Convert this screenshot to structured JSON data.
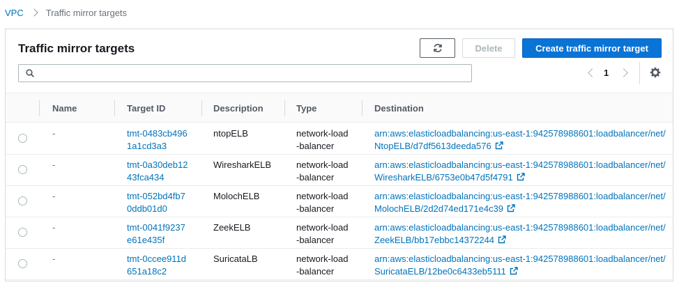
{
  "breadcrumb": {
    "root": "VPC",
    "current": "Traffic mirror targets"
  },
  "panel": {
    "title": "Traffic mirror targets"
  },
  "toolbar": {
    "delete_label": "Delete",
    "create_label": "Create traffic mirror target"
  },
  "search": {
    "placeholder": "",
    "value": ""
  },
  "pagination": {
    "current_page": "1"
  },
  "columns": [
    "Name",
    "Target ID",
    "Description",
    "Type",
    "Destination"
  ],
  "rows": [
    {
      "name": "-",
      "target_id_1": "tmt-0483cb496",
      "target_id_2": "1a1cd3a3",
      "description": "ntopELB",
      "type_1": "network-load",
      "type_2": "-balancer",
      "dest_1": "arn:aws:elasticloadbalancing:us-east-1:942578988601:loadbalancer/net/",
      "dest_2": "NtopELB/d7df5613deeda576"
    },
    {
      "name": "-",
      "target_id_1": "tmt-0a30deb12",
      "target_id_2": "43fca434",
      "description": "WiresharkELB",
      "type_1": "network-load",
      "type_2": "-balancer",
      "dest_1": "arn:aws:elasticloadbalancing:us-east-1:942578988601:loadbalancer/net/",
      "dest_2": "WiresharkELB/6753e0b47d5f4791"
    },
    {
      "name": "-",
      "target_id_1": "tmt-052bd4fb7",
      "target_id_2": "0ddb01d0",
      "description": "MolochELB",
      "type_1": "network-load",
      "type_2": "-balancer",
      "dest_1": "arn:aws:elasticloadbalancing:us-east-1:942578988601:loadbalancer/net/",
      "dest_2": "MolochELB/2d2d74ed171e4c39"
    },
    {
      "name": "-",
      "target_id_1": "tmt-0041f9237",
      "target_id_2": "e61e435f",
      "description": "ZeekELB",
      "type_1": "network-load",
      "type_2": "-balancer",
      "dest_1": "arn:aws:elasticloadbalancing:us-east-1:942578988601:loadbalancer/net/",
      "dest_2": "ZeekELB/bb17ebbc14372244"
    },
    {
      "name": "-",
      "target_id_1": "tmt-0ccee911d",
      "target_id_2": "651a18c2",
      "description": "SuricataLB",
      "type_1": "network-load",
      "type_2": "-balancer",
      "dest_1": "arn:aws:elasticloadbalancing:us-east-1:942578988601:loadbalancer/net/",
      "dest_2": "SuricataELB/12be0c6433eb5111"
    }
  ],
  "icons": {
    "refresh": "refresh-icon",
    "search": "search-icon",
    "settings": "gear-icon",
    "external": "external-link-icon"
  },
  "colors": {
    "link": "#0073bb",
    "primary_button": "#0a73d6",
    "disabled_text": "#aab7b8"
  }
}
